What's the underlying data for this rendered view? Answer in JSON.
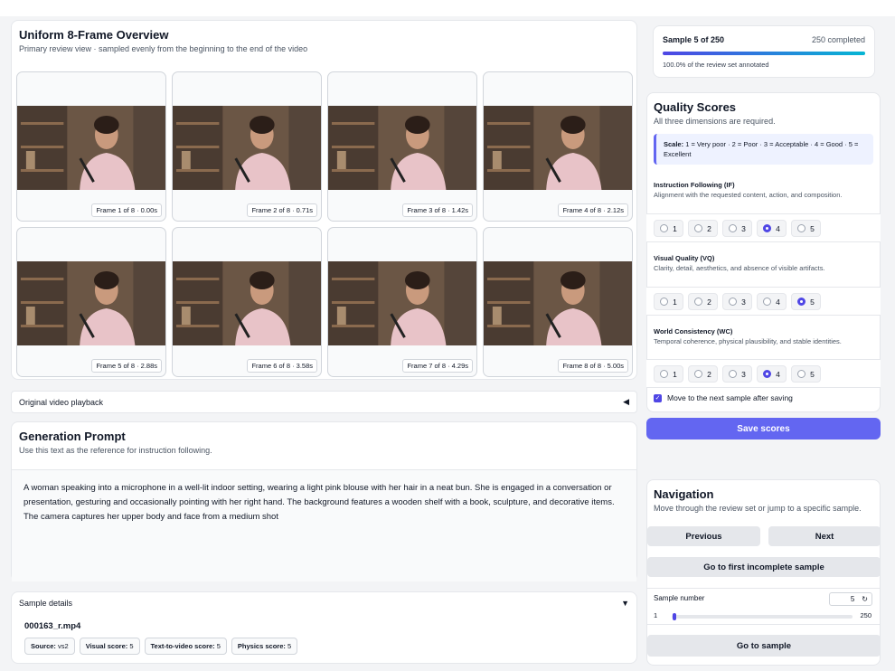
{
  "overview": {
    "title": "Uniform 8-Frame Overview",
    "subtitle": "Primary review view · sampled evenly from the beginning to the end of the video",
    "frames": [
      "Frame 1 of 8 · 0.00s",
      "Frame 2 of 8 · 0.71s",
      "Frame 3 of 8 · 1.42s",
      "Frame 4 of 8 · 2.12s",
      "Frame 5 of 8 · 2.88s",
      "Frame 6 of 8 · 3.58s",
      "Frame 7 of 8 · 4.29s",
      "Frame 8 of 8 · 5.00s"
    ]
  },
  "playback": {
    "label": "Original video playback",
    "caret": "◀"
  },
  "prompt": {
    "title": "Generation Prompt",
    "subtitle": "Use this text as the reference for instruction following.",
    "text": "A woman speaking into a microphone in a well-lit indoor setting, wearing a light pink blouse with her hair in a neat bun. She is engaged in a conversation or presentation, gesturing and occasionally pointing with her right hand. The background features a wooden shelf with a book, sculpture, and decorative items. The camera captures her upper body and face from a medium shot"
  },
  "details": {
    "label": "Sample details",
    "caret": "▼",
    "file": "000163_r.mp4",
    "chips": [
      {
        "key": "Source:",
        "value": "vs2"
      },
      {
        "key": "Visual score:",
        "value": "5"
      },
      {
        "key": "Text-to-video score:",
        "value": "5"
      },
      {
        "key": "Physics score:",
        "value": "5"
      }
    ]
  },
  "progress": {
    "sample": "Sample 5 of 250",
    "completed": "250 completed",
    "note": "100.0% of the review set annotated",
    "fraction": 1.0
  },
  "quality": {
    "title": "Quality Scores",
    "subtitle": "All three dimensions are required.",
    "scale_bold": "Scale:",
    "scale_text": " 1 = Very poor · 2 = Poor · 3 = Acceptable · 4 = Good · 5 = Excellent",
    "options": [
      "1",
      "2",
      "3",
      "4",
      "5"
    ],
    "dimensions": [
      {
        "title": "Instruction Following (IF)",
        "desc": "Alignment with the requested content, action, and composition.",
        "selected": 4
      },
      {
        "title": "Visual Quality (VQ)",
        "desc": "Clarity, detail, aesthetics, and absence of visible artifacts.",
        "selected": 5
      },
      {
        "title": "World Consistency (WC)",
        "desc": "Temporal coherence, physical plausibility, and stable identities.",
        "selected": 4
      }
    ],
    "autonext": "Move to the next sample after saving"
  },
  "save_label": "Save scores",
  "navigation": {
    "title": "Navigation",
    "subtitle": "Move through the review set or jump to a specific sample.",
    "previous": "Previous",
    "next": "Next",
    "first_incomplete": "Go to first incomplete sample",
    "sample_number_label": "Sample number",
    "sample_value": "5",
    "reset_icon": "↻",
    "slider_min": "1",
    "slider_max": "250",
    "slider_value": 5,
    "go_label": "Go to sample"
  },
  "colors": {
    "accent": "#6366f1",
    "accent_dark": "#4f46e5",
    "progress_end": "#06b6d4"
  }
}
